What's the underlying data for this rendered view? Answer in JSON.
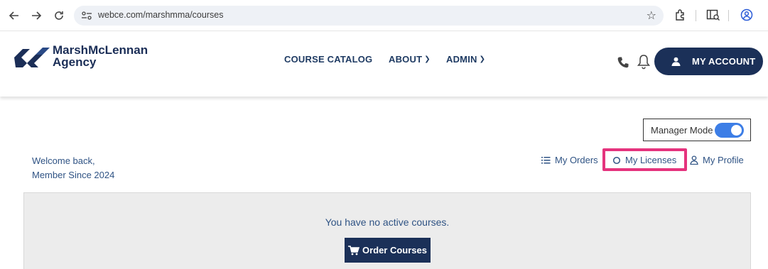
{
  "browser": {
    "url": "webce.com/marshmma/courses"
  },
  "header": {
    "logo_line1": "MarshMcLennan",
    "logo_line2": "Agency",
    "menu": {
      "course_catalog": "COURSE CATALOG",
      "about": "ABOUT",
      "admin": "ADMIN"
    },
    "account_label": "MY ACCOUNT"
  },
  "manager_mode": {
    "label": "Manager Mode",
    "enabled": true
  },
  "welcome": {
    "line1": "Welcome back,",
    "line2": "Member Since 2024"
  },
  "account_links": {
    "orders": "My Orders",
    "licenses": "My Licenses",
    "profile": "My Profile"
  },
  "courses": {
    "empty_message": "You have no active courses.",
    "order_button": "Order Courses"
  },
  "colors": {
    "brand_navy": "#1b3058",
    "link_blue": "#2f5384",
    "toggle_blue": "#3d7ee6",
    "highlight_pink": "#e5337d"
  },
  "icons": [
    "back-icon",
    "forward-icon",
    "reload-icon",
    "site-settings-icon",
    "star-icon",
    "extensions-icon",
    "side-panel-icon",
    "profile-icon",
    "phone-icon",
    "bell-icon",
    "user-icon",
    "list-icon",
    "circle-icon",
    "person-outline-icon",
    "cart-icon"
  ]
}
